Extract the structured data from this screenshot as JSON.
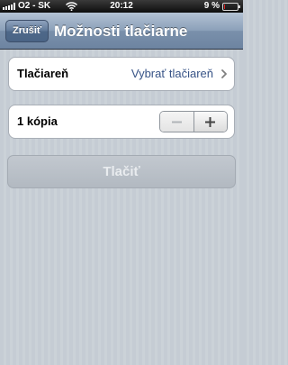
{
  "status_bar": {
    "carrier": "O2 - SK",
    "time": "20:12",
    "battery_percent": "9 %",
    "battery_level": 0.09,
    "battery_color": "#e02020"
  },
  "nav": {
    "cancel_label": "Zrušiť",
    "title": "Možnosti tlačiarne"
  },
  "printer_row": {
    "label": "Tlačiareň",
    "value": "Vybrať tlačiareň",
    "icon": "chevron-right-icon"
  },
  "copies_row": {
    "label": "1 kópia",
    "minus_icon": "minus-icon",
    "plus_icon": "plus-icon"
  },
  "print_button": {
    "label": "Tlačiť",
    "enabled": false
  }
}
